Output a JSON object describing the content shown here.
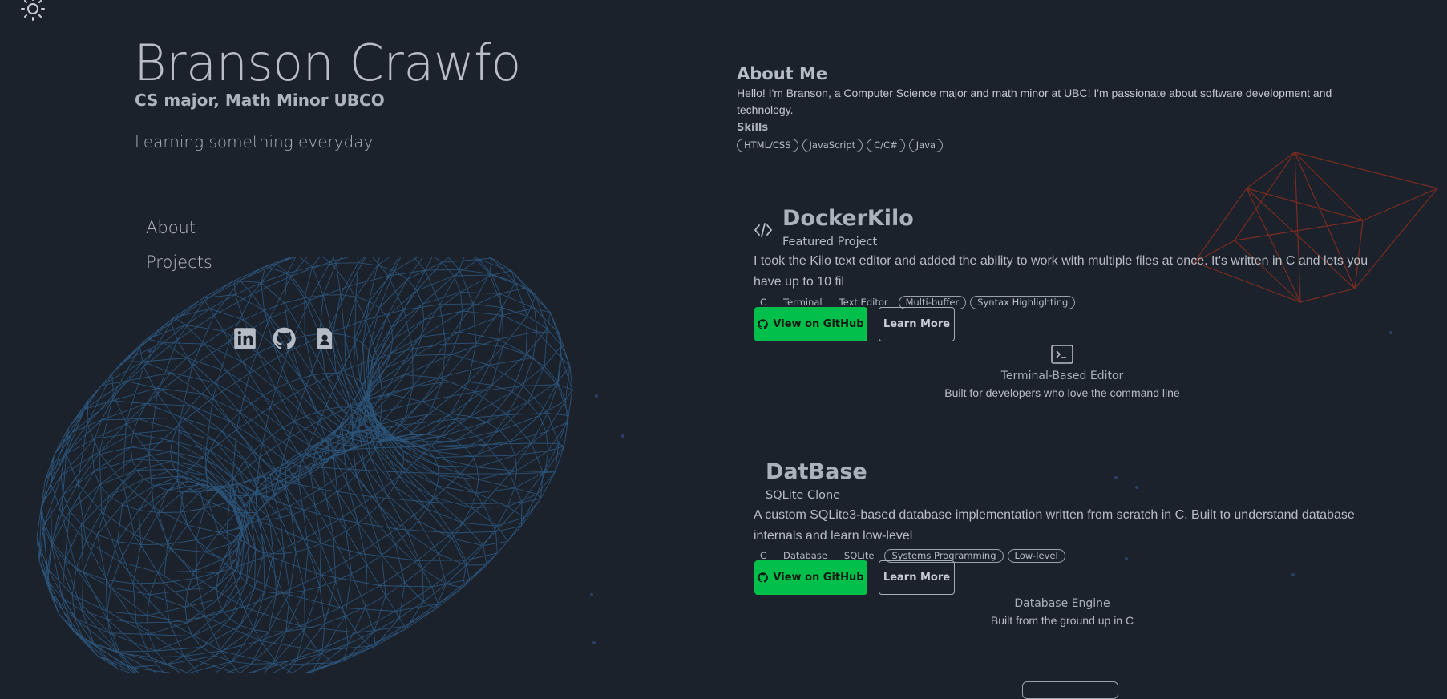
{
  "header": {
    "name": "Branson Crawfo",
    "subtitle": "CS major, Math Minor UBCO",
    "tagline": "Learning something everyday"
  },
  "nav": {
    "items": [
      {
        "label": "About"
      },
      {
        "label": "Projects"
      }
    ]
  },
  "social": {
    "icons": [
      "linkedin-icon",
      "github-icon",
      "resume-icon"
    ]
  },
  "about": {
    "heading": "About Me",
    "text": "Hello! I'm Branson, a Computer Science major and math minor at UBC! I'm passionate about software development and technology.",
    "skills_label": "Skills",
    "skills": [
      "HTML/CSS",
      "JavaScript",
      "C/C#",
      "Java"
    ]
  },
  "projects": [
    {
      "title": "DockerKilo",
      "subtitle": "Featured Project",
      "description": "I took the Kilo text editor and added the ability to work with multiple files at once. It's written in C and lets you have up to 10 fil",
      "tags_plain": [
        "C",
        "Terminal",
        "Text Editor"
      ],
      "tags_pill": [
        "Multi-buffer",
        "Syntax Highlighting"
      ],
      "github_label": "View on GitHub",
      "learn_label": "Learn More",
      "feature_caption": "Terminal-Based Editor",
      "feature_desc": "Built for developers who love the command line"
    },
    {
      "title": "DatBase",
      "subtitle": "SQLite Clone",
      "description": "A custom SQLite3-based database implementation written from scratch in C. Built to understand database internals and learn low-level",
      "tags_plain": [
        "C",
        "Database",
        "SQLite"
      ],
      "tags_pill": [
        "Systems Programming",
        "Low-level"
      ],
      "github_label": "View on GitHub",
      "learn_label": "Learn More",
      "feature_caption": "Database Engine",
      "feature_desc": "Built from the ground up in C"
    }
  ],
  "colors": {
    "background": "#1c222b",
    "github_button": "#00c04b",
    "torus_wire": "#2e5a85",
    "polyhedron_wire": "#7a2c20",
    "text": "#c9ced6"
  }
}
